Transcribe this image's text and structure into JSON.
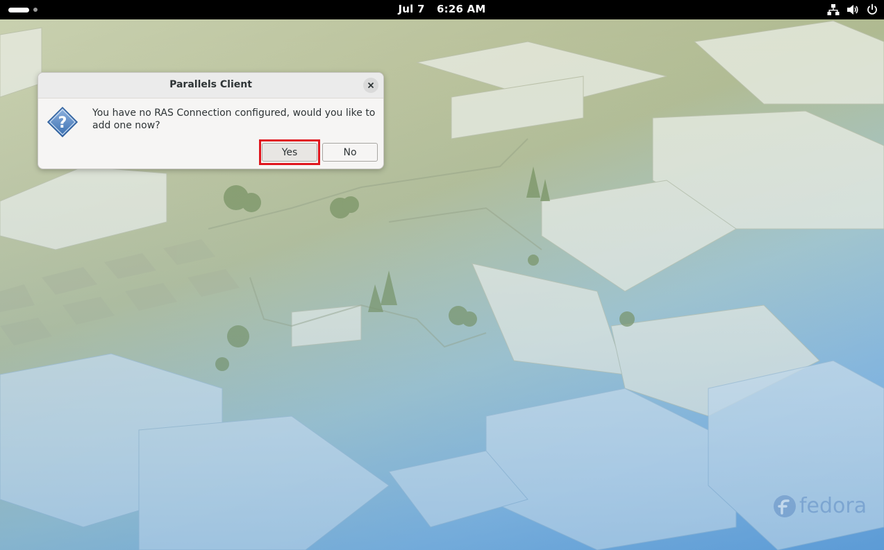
{
  "topbar": {
    "date": "Jul 7",
    "time": "6:26 AM",
    "tray_icons": [
      "network-icon",
      "volume-icon",
      "power-icon"
    ]
  },
  "dialog": {
    "title": "Parallels Client",
    "message": "You have no RAS Connection configured, would you like to add one now?",
    "yes_label": "Yes",
    "no_label": "No",
    "icon": "question-icon",
    "highlight_color": "#e0161e"
  },
  "wallpaper": {
    "watermark": "fedora"
  }
}
